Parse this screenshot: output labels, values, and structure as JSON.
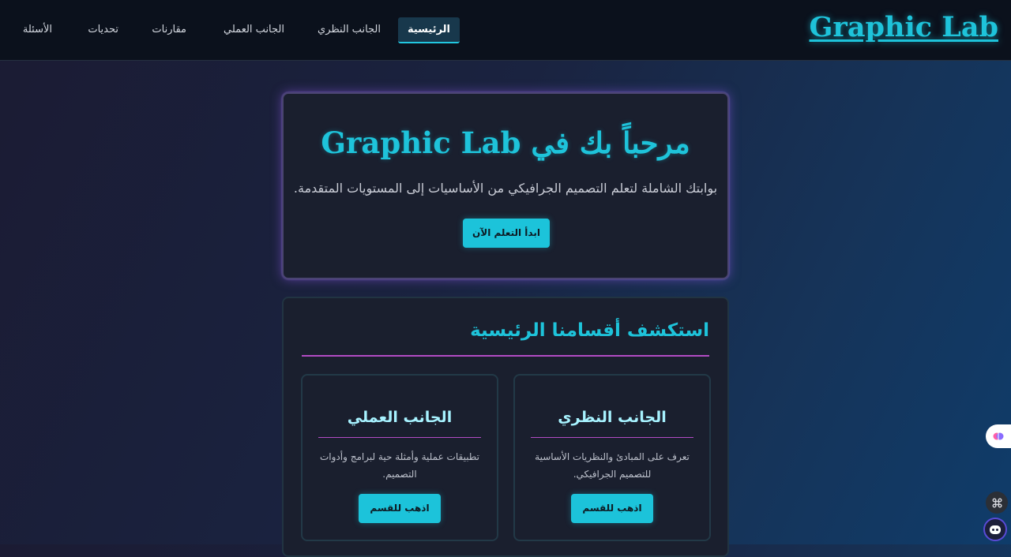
{
  "brand": {
    "logo": "Graphic Lab"
  },
  "nav": {
    "items": [
      {
        "label": "الرئيسية",
        "active": true
      },
      {
        "label": "الجانب النظري"
      },
      {
        "label": "الجانب العملي"
      },
      {
        "label": "مقارنات"
      },
      {
        "label": "تحديات"
      },
      {
        "label": "الأسئلة"
      }
    ]
  },
  "hero": {
    "title": "مرحباً بك في Graphic Lab",
    "subtitle": "بوابتك الشاملة لتعلم التصميم الجرافيكي من الأساسيات إلى المستويات المتقدمة.",
    "cta_label": "ابدأ التعلم الآن"
  },
  "sections": {
    "title": "استكشف أقسامنا الرئيسية",
    "cards": [
      {
        "title": "الجانب النظري",
        "description": "تعرف على المبادئ والنظريات الأساسية للتصميم الجرافيكي.",
        "button_label": "اذهب للقسم"
      },
      {
        "title": "الجانب العملي",
        "description": "تطبيقات عملية وأمثلة حية لبرامج وأدوات التصميم.",
        "button_label": "اذهب للقسم"
      }
    ]
  },
  "floating": {
    "icons": [
      "brain-icon",
      "command-icon",
      "chatbot-icon"
    ]
  },
  "colors": {
    "accent": "#1ec3da",
    "divider": "#b24bc4",
    "navbar": "#0b111c",
    "card": "#1a1f2e"
  }
}
